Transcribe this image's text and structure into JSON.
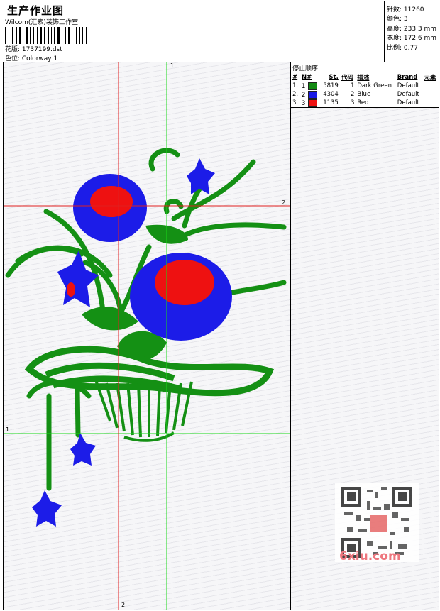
{
  "header": {
    "title": "生产作业图",
    "studio": "Wilcom(汇索)装饰工作室",
    "design_label": "花版: 1737199.dst",
    "color_label": "色位:  Colorway 1"
  },
  "stats": {
    "stitches": "针数:  11260",
    "colors": "颜色:  3",
    "height": "高度:  233.3 mm",
    "width": "宽度:  172.6 mm",
    "scale": "比例:  0.77"
  },
  "stop_sequence": {
    "title": "停止顺序:",
    "columns": [
      "#",
      "N#",
      "St.",
      "代码",
      "描述",
      "Brand",
      "元素"
    ],
    "rows": [
      {
        "idx": "1.",
        "n": "1",
        "st": "5819",
        "code": "1",
        "desc": "Dark Green",
        "brand": "Default",
        "color": "#128a12"
      },
      {
        "idx": "2.",
        "n": "2",
        "st": "4304",
        "code": "2",
        "desc": "Blue",
        "brand": "Default",
        "color": "#1a1ae6"
      },
      {
        "idx": "3.",
        "n": "3",
        "st": "1135",
        "code": "3",
        "desc": "Red",
        "brand": "Default",
        "color": "#ee1111"
      }
    ]
  },
  "guides": {
    "green_v": "1",
    "green_h": "1",
    "red_h": "2",
    "red_v": "2"
  },
  "watermark": {
    "site": "6xiu.com"
  }
}
